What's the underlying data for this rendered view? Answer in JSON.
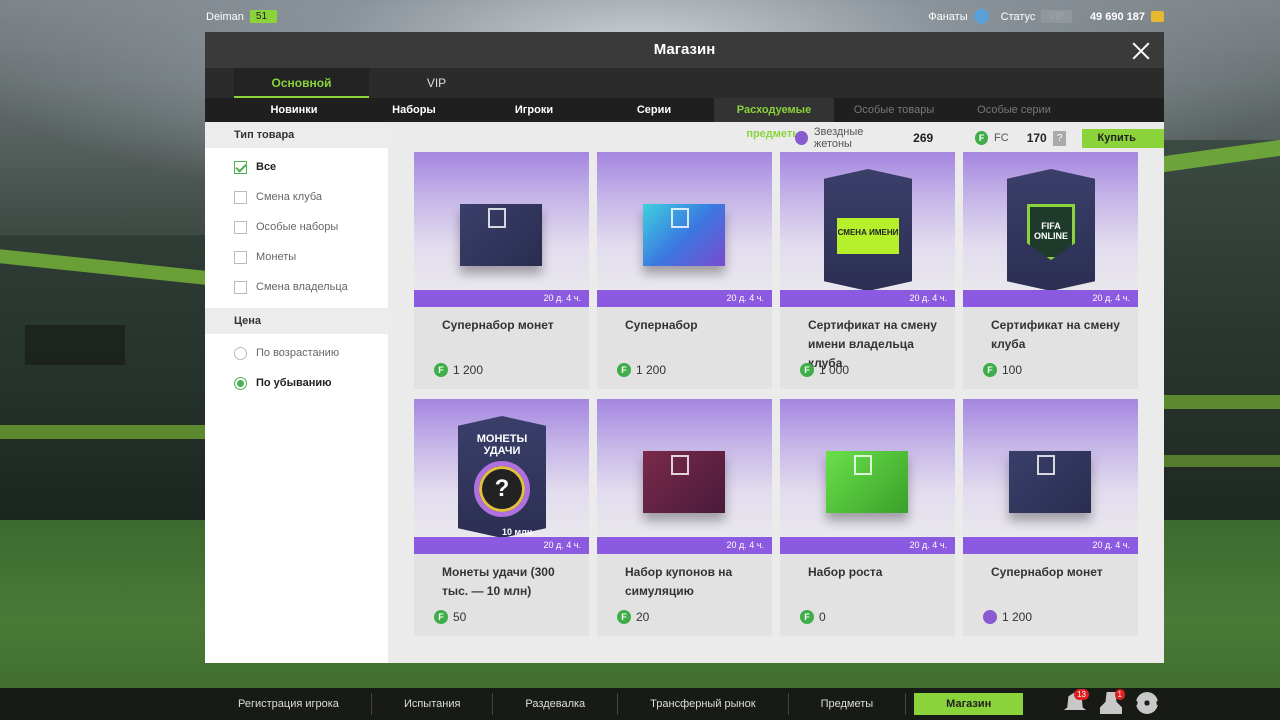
{
  "hud": {
    "player_name": "Deiman",
    "level": "51",
    "fans_label": "Фанаты",
    "status_label": "Статус",
    "vip_label": "VIP",
    "coins": "49 690 187"
  },
  "modal": {
    "title": "Магазин",
    "main_tabs": [
      "Основной",
      "VIP"
    ],
    "sub_tabs": [
      "Новинки",
      "Наборы",
      "Игроки",
      "Серии",
      "Расходуемые предметы",
      "Особые товары",
      "Особые серии"
    ]
  },
  "sidebar": {
    "type_heading": "Тип товара",
    "type_options": [
      "Все",
      "Смена клуба",
      "Особые наборы",
      "Монеты",
      "Смена владельца"
    ],
    "price_heading": "Цена",
    "price_options": [
      "По возрастанию",
      "По убыванию"
    ]
  },
  "currency": {
    "star_label": "Звездные жетоны",
    "star_value": "269",
    "fc_label": "FC",
    "fc_value": "170",
    "help": "?",
    "buy_fc": "Купить FC"
  },
  "products": [
    {
      "name": "Супернабор монет",
      "price": "1 200",
      "timer": "20 д. 4 ч.",
      "currency": "fc"
    },
    {
      "name": "Супернабор",
      "price": "1 200",
      "timer": "20 д. 4 ч.",
      "currency": "fc"
    },
    {
      "name": "Сертификат на смену имени владельца клуба",
      "price": "1 000",
      "timer": "20 д. 4 ч.",
      "currency": "fc",
      "art_text": "СМЕНА ИМЕНИ"
    },
    {
      "name": "Сертификат на смену клуба",
      "price": "100",
      "timer": "20 д. 4 ч.",
      "currency": "fc",
      "art_text": "FIFA ONLINE"
    },
    {
      "name": "Монеты удачи (300 тыс. — 10 млн)",
      "price": "50",
      "timer": "20 д. 4 ч.",
      "currency": "fc",
      "art_text": "МОНЕТЫ УДАЧИ",
      "art_sub": "10 млн"
    },
    {
      "name": "Набор купонов на симуляцию",
      "price": "20",
      "timer": "20 д. 4 ч.",
      "currency": "fc"
    },
    {
      "name": "Набор роста",
      "price": "0",
      "timer": "20 д. 4 ч.",
      "currency": "fc"
    },
    {
      "name": "Супернабор монет",
      "price": "1 200",
      "timer": "20 д. 4 ч.",
      "currency": "star"
    }
  ],
  "bottom_nav": [
    "Регистрация игрока",
    "Испытания",
    "Раздевалка",
    "Трансферный рынок",
    "Предметы",
    "Магазин"
  ],
  "notifications": {
    "bell": "13",
    "friends": "1"
  },
  "colors": {
    "accent": "#8ad33b",
    "timer_bar": "#8c5ae0",
    "fc": "#3fae4a",
    "star": "#8a5ad0"
  }
}
